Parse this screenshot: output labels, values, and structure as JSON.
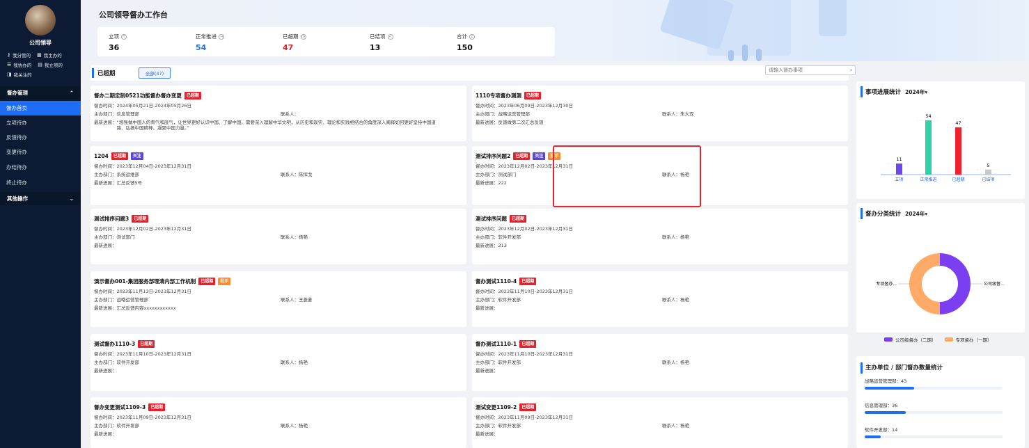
{
  "sidebar": {
    "user": "公司领导",
    "quick": [
      "我分管的",
      "我主办的",
      "我协办的",
      "我立项的",
      "我关注的"
    ],
    "group1": "督办管理",
    "items": [
      "督办首页",
      "立项待办",
      "反馈待办",
      "变更待办",
      "办结待办",
      "终止待办"
    ],
    "group2": "其他操作"
  },
  "header": {
    "title": "公司领导督办工作台"
  },
  "stats": [
    {
      "label": "立项",
      "icon": "plus-circle-icon",
      "value": "36",
      "color": "#111111"
    },
    {
      "label": "正常推进",
      "icon": "arrow-circle-icon",
      "value": "54",
      "color": "#1e6df6"
    },
    {
      "label": "已超期",
      "icon": "clock-circle-icon",
      "value": "47",
      "color": "#e5212b"
    },
    {
      "label": "已结项",
      "icon": "check-circle-icon",
      "value": "13",
      "color": "#111111"
    },
    {
      "label": "合计",
      "icon": "sum-circle-icon",
      "value": "150",
      "color": "#111111"
    }
  ],
  "toolbar": {
    "title": "已超期",
    "tab_all": "全部(47)",
    "search_placeholder": "请输入督办事项"
  },
  "labels": {
    "time": "督办时间：",
    "dept": "主办部门：",
    "contact": "联系人：",
    "progress": "最新进展："
  },
  "cards": [
    {
      "title": "督办二期定制0521功能督办督办变更",
      "tags": [
        {
          "t": "已超期",
          "c": "red"
        }
      ],
      "time": "2024年05月21日-2024年05月26日",
      "dept": "信息管理部",
      "contact": "",
      "progress": "“增强做中国人的骨气和底气，让世界更好认识中国、了解中国。需要深入理解中华文明，从历史和现实、理论和实践相结合的角度深入阐释如何更好坚持中国道路、弘扬中国精神、凝聚中国力量。”"
    },
    {
      "title": "1110专项督办测测",
      "tags": [
        {
          "t": "已超期",
          "c": "red"
        }
      ],
      "time": "2023年06月09日-2023年12月30日",
      "dept": "战略运营管理部",
      "contact": "朱大双",
      "progress": "反馈做第二次汇总反馈"
    },
    {
      "title": "1204",
      "tags": [
        {
          "t": "已超期",
          "c": "red"
        },
        {
          "t": "关注",
          "c": "purple"
        }
      ],
      "time": "2023年12月04日-2023年12月31日",
      "dept": "系统运维部",
      "contact": "陈挥戈",
      "progress": "汇总反馈5号"
    },
    {
      "title": "测试排序问题2",
      "tags": [
        {
          "t": "已超期",
          "c": "red"
        },
        {
          "t": "关注",
          "c": "purple"
        },
        {
          "t": "批示",
          "c": "orange"
        }
      ],
      "time": "2023年12月02日-2023年12月31日",
      "dept": "测试部门",
      "contact": "杨艳",
      "progress": "222"
    },
    {
      "title": "测试排序问题3",
      "tags": [
        {
          "t": "已超期",
          "c": "red"
        }
      ],
      "time": "2023年12月02日-2023年12月31日",
      "dept": "测试部门",
      "contact": "杨艳",
      "progress": ""
    },
    {
      "title": "测试排序问题",
      "tags": [
        {
          "t": "已超期",
          "c": "red"
        }
      ],
      "time": "2023年12月02日-2023年12月31日",
      "dept": "软件开发部",
      "contact": "杨艳",
      "progress": "213"
    },
    {
      "title": "演示督办001-集团服务部理清内部工作机制",
      "tags": [
        {
          "t": "已超期",
          "c": "red"
        },
        {
          "t": "批示",
          "c": "orange"
        }
      ],
      "time": "2023年11月13日-2023年12月31日",
      "dept": "战略运营管理部",
      "contact": "王菱菱",
      "progress": "汇总反馈内容xxxxxxxxxxxx"
    },
    {
      "title": "督办测试1110-4",
      "tags": [
        {
          "t": "已超期",
          "c": "red"
        }
      ],
      "time": "2023年11月10日-2023年12月31日",
      "dept": "软件开发部",
      "contact": "杨艳",
      "progress": ""
    },
    {
      "title": "测试督办1110-3",
      "tags": [
        {
          "t": "已超期",
          "c": "red"
        }
      ],
      "time": "2023年11月10日-2023年12月31日",
      "dept": "软件开发部",
      "contact": "杨艳",
      "progress": ""
    },
    {
      "title": "督办测试1110-1",
      "tags": [
        {
          "t": "已超期",
          "c": "red"
        }
      ],
      "time": "2023年11月10日-2023年12月31日",
      "dept": "软件开发部",
      "contact": "杨艳",
      "progress": ""
    },
    {
      "title": "督办变更测试1109-3",
      "tags": [
        {
          "t": "已超期",
          "c": "red"
        }
      ],
      "time": "2023年11月09日-2023年12月31日",
      "dept": "软件开发部",
      "contact": "杨艳",
      "progress": ""
    },
    {
      "title": "测试变更1109-2",
      "tags": [
        {
          "t": "已超期",
          "c": "red"
        }
      ],
      "time": "2023年11月09日-2023年12月31日",
      "dept": "软件开发部",
      "contact": "杨艳",
      "progress": ""
    }
  ],
  "panels": {
    "progress": {
      "title": "事项进展统计",
      "year": "2024年▾"
    },
    "category": {
      "title": "督办分类统计",
      "year": "2024年▾",
      "label_left": "专项督办...",
      "label_right": "公司级督..."
    },
    "dept": {
      "title": "主办单位 / 部门督办数量统计"
    }
  },
  "chart_data": [
    {
      "type": "bar",
      "title": "事项进展统计",
      "categories": [
        "立项",
        "正常推进",
        "已超期",
        "已结项"
      ],
      "series": [
        {
          "values": [
            11,
            54,
            47,
            5
          ]
        }
      ],
      "colors": [
        "#6c48e8",
        "#2fd1a8",
        "#f0222f",
        "#c8c8c8"
      ]
    },
    {
      "type": "pie",
      "title": "督办分类统计",
      "slices": [
        {
          "name": "公司级督办（二期）",
          "value": 50,
          "color": "#7b3ff2"
        },
        {
          "name": "专项督办（一期）",
          "value": 50,
          "color": "#ffaa66"
        }
      ]
    },
    {
      "type": "bar",
      "title": "主办单位 / 部门督办数量统计",
      "categories": [
        "战略运营管理部",
        "信息管理部",
        "软件开发部"
      ],
      "values": [
        43,
        36,
        14
      ]
    }
  ]
}
